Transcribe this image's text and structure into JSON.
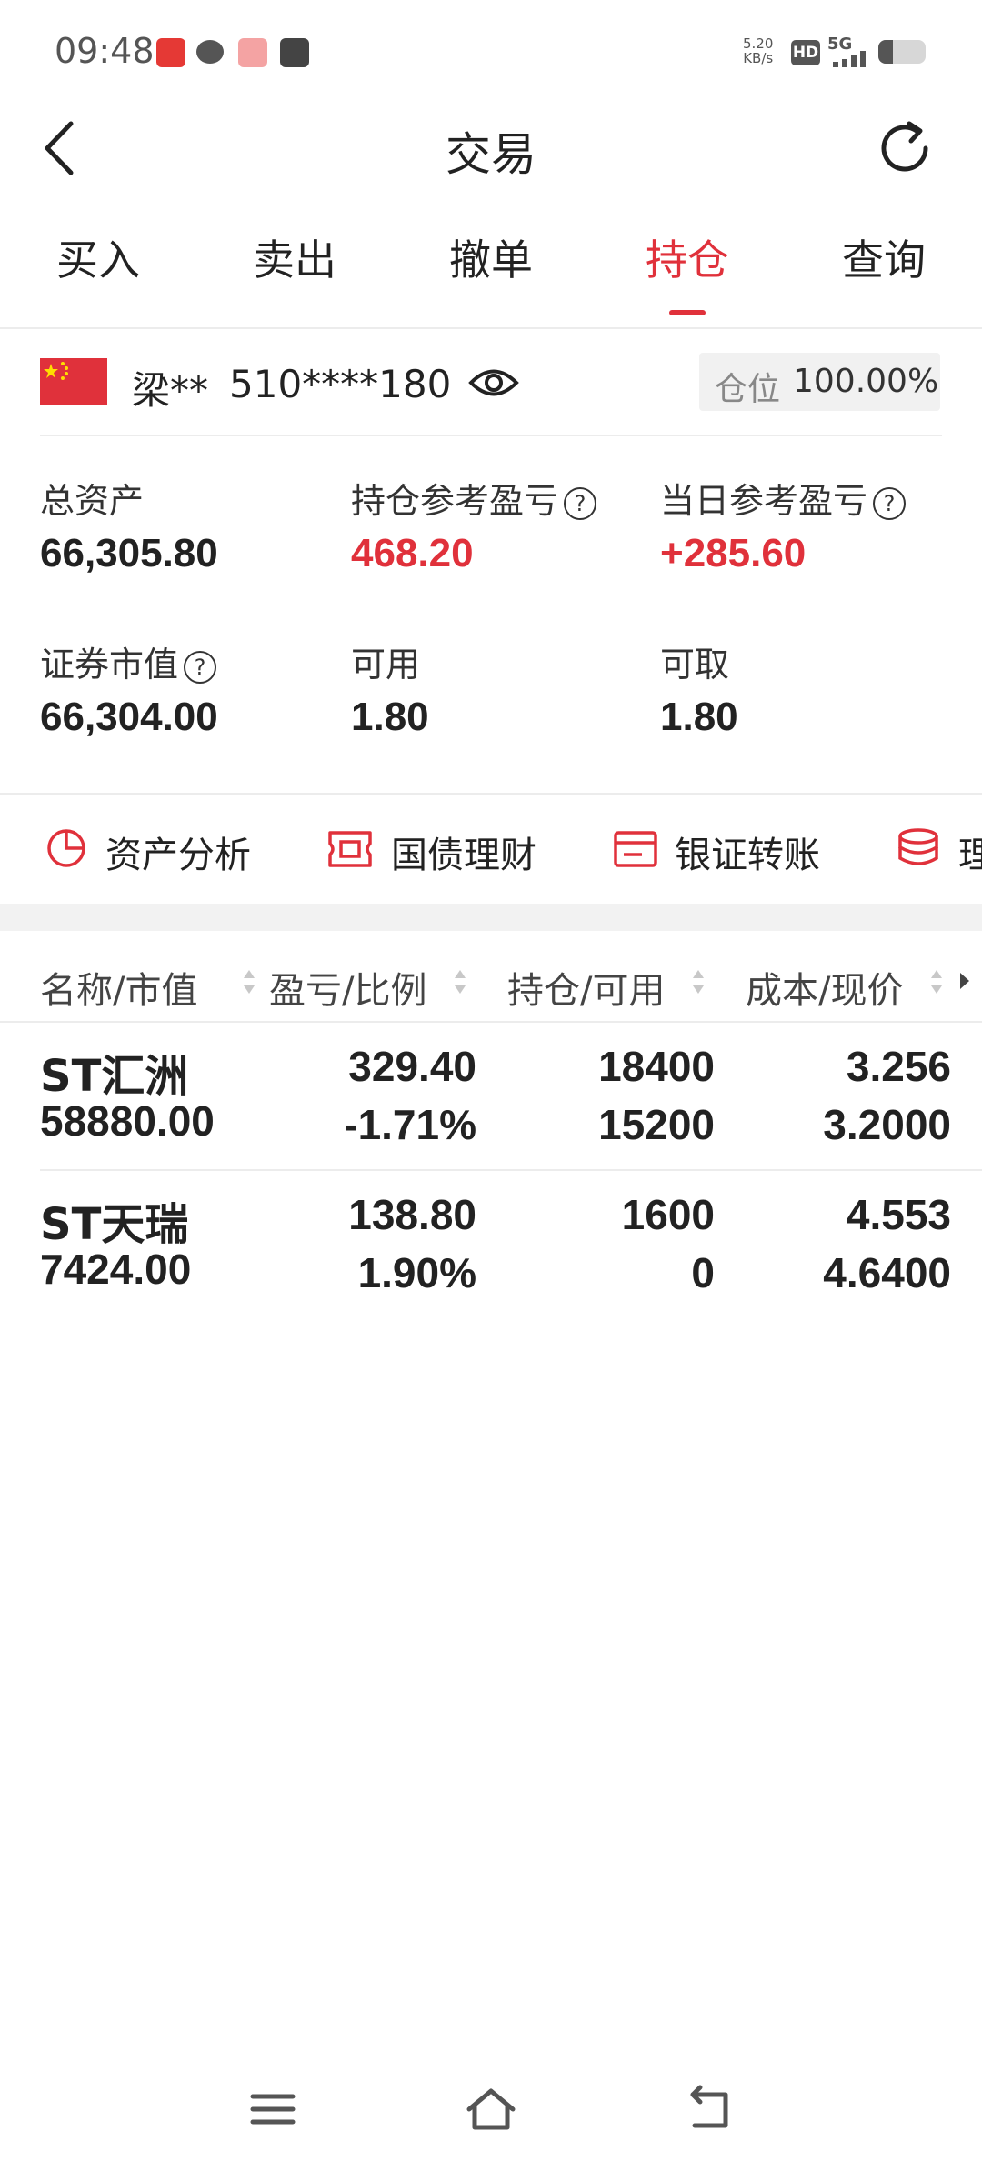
{
  "status_bar": {
    "time": "09:48",
    "net_speed_value": "5.20",
    "net_speed_unit": "KB/s",
    "hd": "HD",
    "network": "5G",
    "battery_level": 0.3,
    "app_icons": [
      "brokerage-app-icon",
      "message-icon",
      "game-app-icon",
      "shopping-bag-icon"
    ]
  },
  "header": {
    "title": "交易",
    "back_icon": "chevron-left-icon",
    "refresh_icon": "refresh-icon"
  },
  "tabs": [
    {
      "label": "买入"
    },
    {
      "label": "卖出"
    },
    {
      "label": "撤单"
    },
    {
      "label": "持仓",
      "active": true
    },
    {
      "label": "查询"
    }
  ],
  "account": {
    "name": "梁**",
    "id": "510****180",
    "position_label": "仓位",
    "position_value": "100.00%"
  },
  "metrics": {
    "total_assets_label": "总资产",
    "total_assets_value": "66,305.80",
    "holding_pl_label": "持仓参考盈亏",
    "holding_pl_value": "468.20",
    "daily_pl_label": "当日参考盈亏",
    "daily_pl_value": "+285.60",
    "securities_value_label": "证券市值",
    "securities_value_value": "66,304.00",
    "available_label": "可用",
    "available_value": "1.80",
    "withdrawable_label": "可取",
    "withdrawable_value": "1.80",
    "help_glyph": "?"
  },
  "quick_actions": [
    {
      "label": "资产分析",
      "icon": "pie-chart-icon"
    },
    {
      "label": "国债理财",
      "icon": "ticket-icon"
    },
    {
      "label": "银证转账",
      "icon": "card-transfer-icon"
    },
    {
      "label": "理",
      "icon": "coins-stack-icon"
    }
  ],
  "table": {
    "headers": [
      "名称/市值",
      "盈亏/比例",
      "持仓/可用",
      "成本/现价"
    ],
    "rows": [
      {
        "name": "ST汇洲",
        "market_value": "58880.00",
        "pl": "329.40",
        "pl_ratio": "-1.71%",
        "holding": "18400",
        "available": "15200",
        "cost": "3.256",
        "price": "3.2000"
      },
      {
        "name": "ST天瑞",
        "market_value": "7424.00",
        "pl": "138.80",
        "pl_ratio": "1.90%",
        "holding": "1600",
        "available": "0",
        "cost": "4.553",
        "price": "4.6400"
      }
    ]
  },
  "colors": {
    "accent": "#e0313b",
    "text": "#222222",
    "muted": "#888888"
  }
}
